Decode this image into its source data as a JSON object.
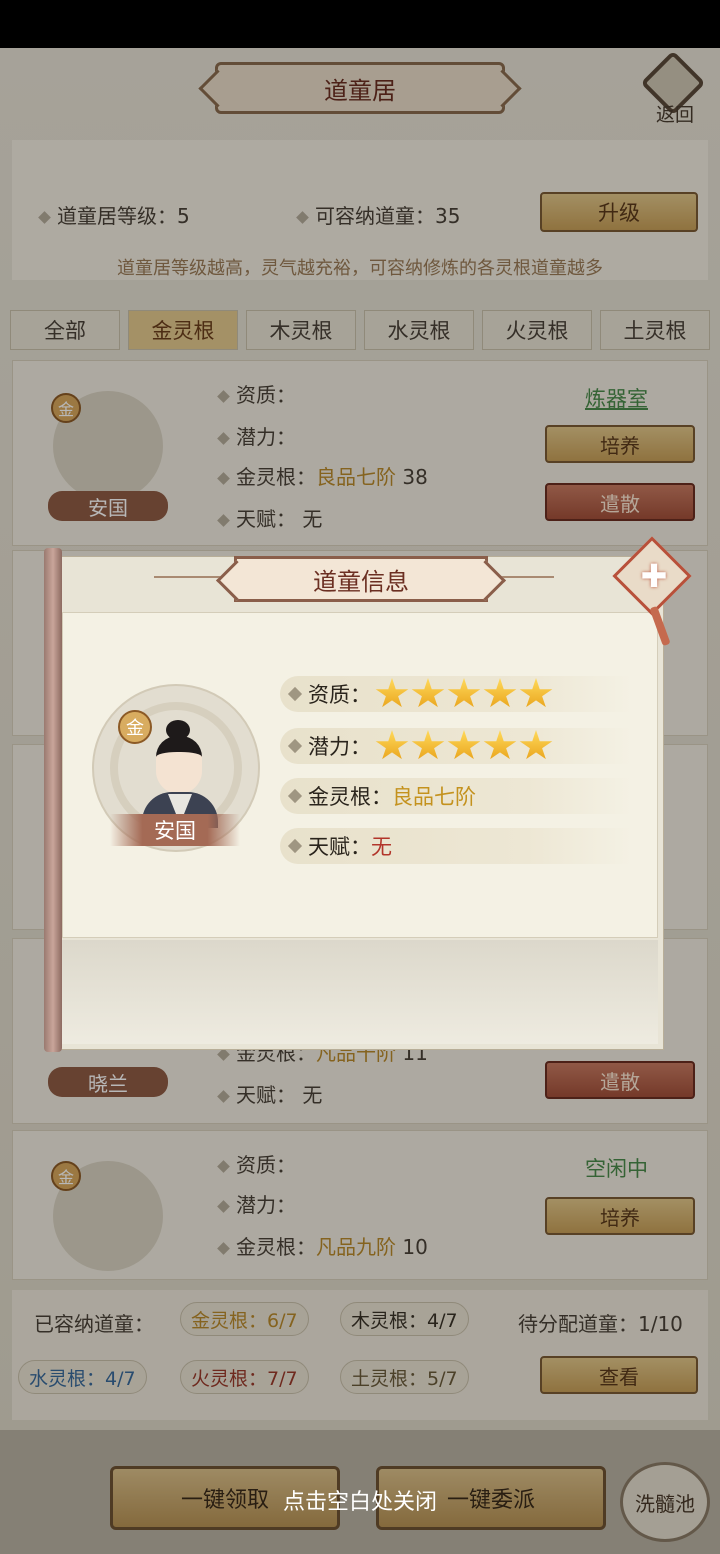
{
  "header": {
    "title": "道童居",
    "back_label": "返回"
  },
  "info": {
    "level_label": "道童居等级：5",
    "capacity_label": "可容纳道童：35",
    "upgrade_label": "升级",
    "tip": "道童居等级越高，灵气越充裕，可容纳修炼的各灵根道童越多"
  },
  "tabs": [
    "全部",
    "金灵根",
    "木灵根",
    "水灵根",
    "火灵根",
    "土灵根"
  ],
  "cards": [
    {
      "badge": "金",
      "name": "安国",
      "qual_label": "资质：",
      "pot_label": "潜力：",
      "root_label": "金灵根：",
      "root_value": "良品七阶",
      "root_level": "38",
      "talent_label": "天赋：",
      "talent_value": "无",
      "status": "炼器室",
      "train": "培养",
      "dismiss": "遣散"
    },
    {
      "name": "晓兰",
      "root_label": "金灵根：",
      "root_value": "凡品十阶",
      "root_level": "11",
      "talent_label": "天赋：",
      "talent_value": "无",
      "dismiss": "遣散"
    },
    {
      "badge": "金",
      "qual_label": "资质：",
      "pot_label": "潜力：",
      "root_label": "金灵根：",
      "root_value": "凡品九阶",
      "root_level": "10",
      "status": "空闲中",
      "train": "培养"
    }
  ],
  "summary": {
    "housed_label": "已容纳道童：",
    "gold": "金灵根：6/7",
    "wood": "木灵根：4/7",
    "pending": "待分配道童：1/10",
    "water": "水灵根：4/7",
    "fire": "火灵根：7/7",
    "earth": "土灵根：5/7",
    "view_label": "查看"
  },
  "bottom": {
    "collect_label": "一键领取",
    "assign_label": "一键委派",
    "wash_label": "洗髓池"
  },
  "modal": {
    "title": "道童信息",
    "badge": "金",
    "name": "安国",
    "quality_label": "资质：",
    "quality_stars": 5,
    "potential_label": "潜力：",
    "potential_stars": 5,
    "root_label": "金灵根：",
    "root_value": "良品七阶",
    "talent_label": "天赋：",
    "talent_value": "无"
  },
  "close_hint": "点击空白处关闭",
  "colors": {
    "gold_text": "#c4921e",
    "red_text": "#b2352a",
    "star": "#f2b62a"
  }
}
